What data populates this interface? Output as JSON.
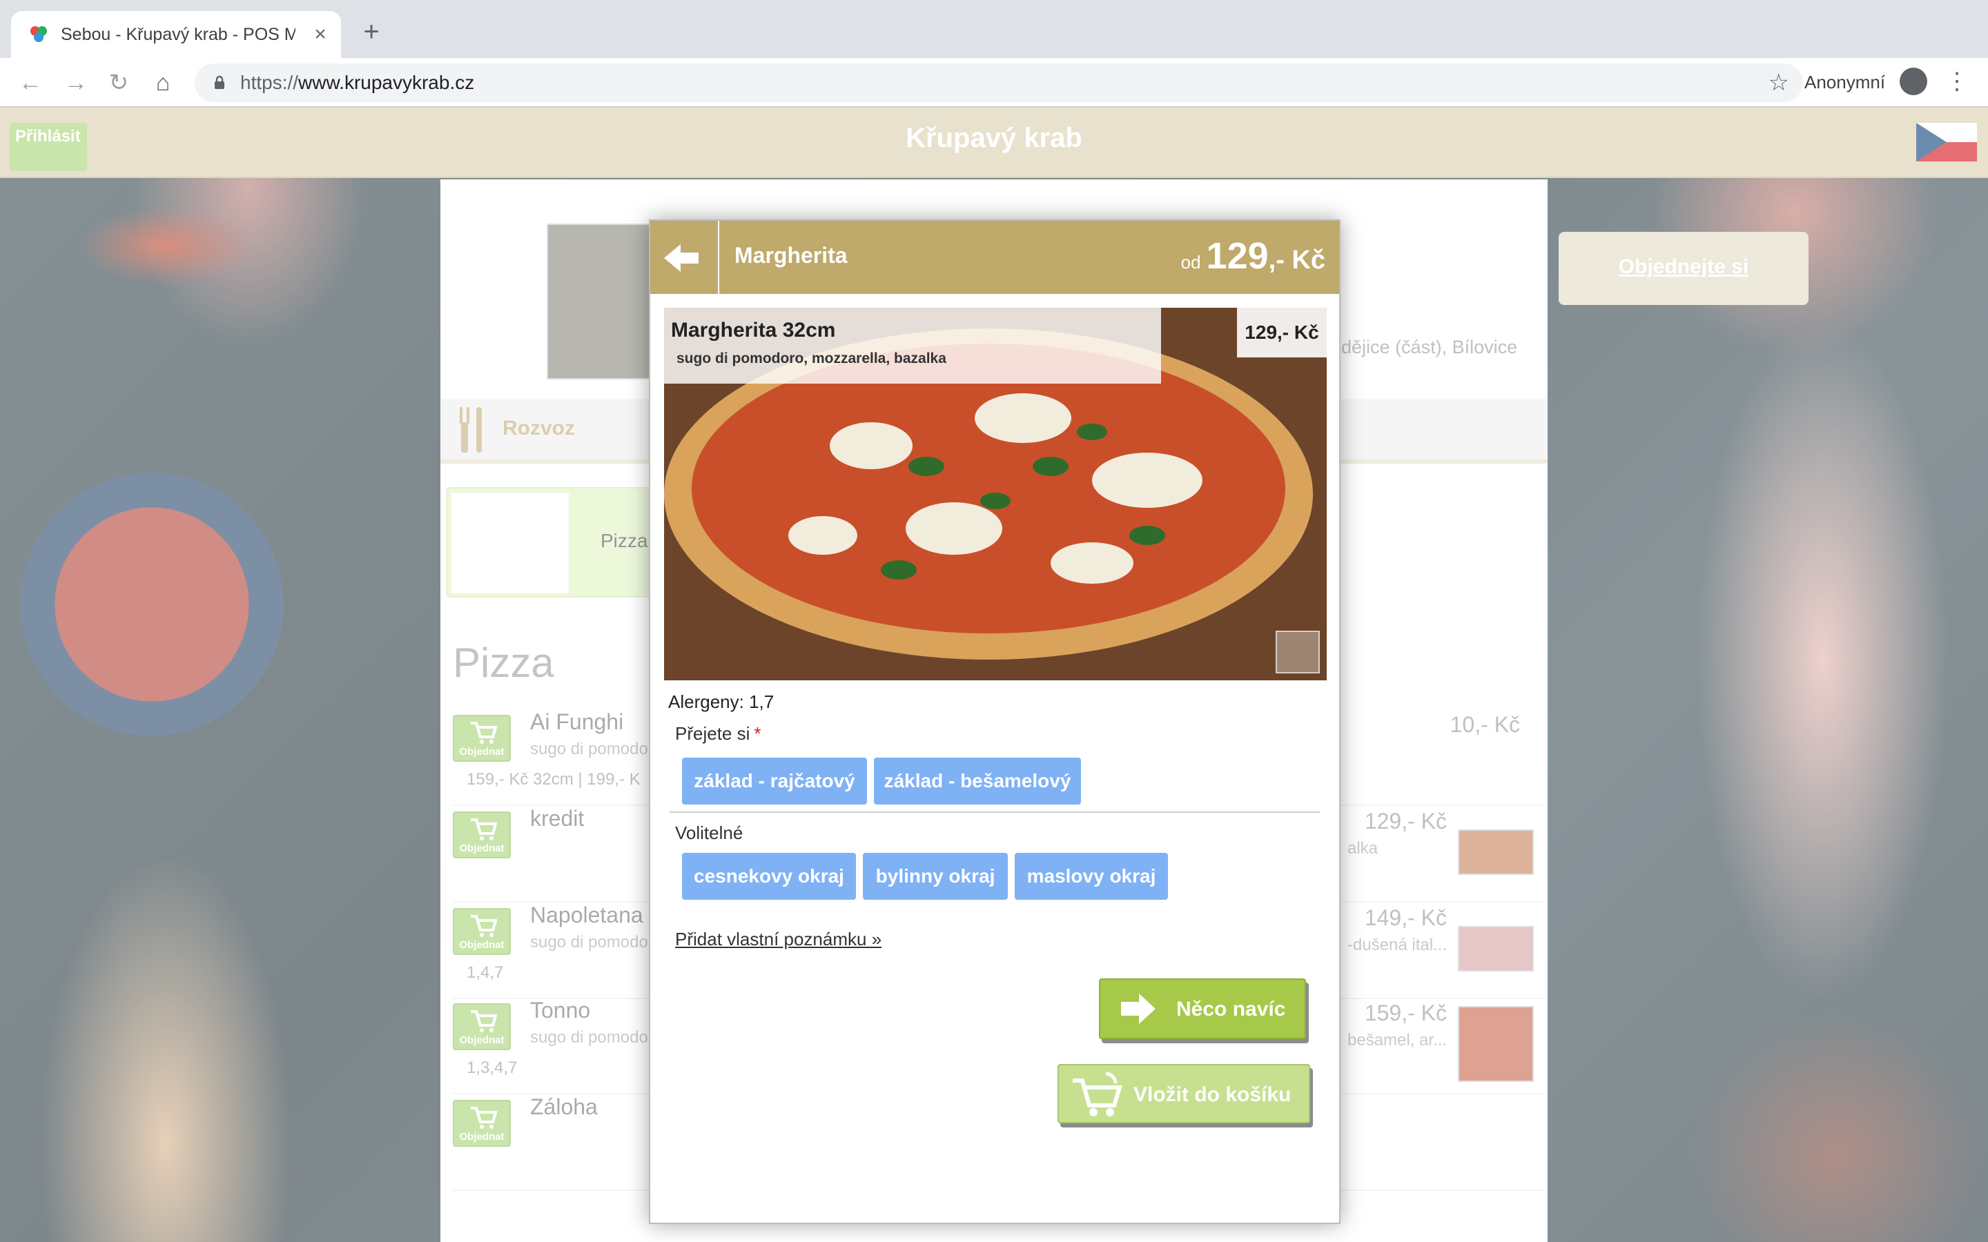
{
  "browser": {
    "tab_title": "Sebou - Křupavý krab - POS M",
    "url_scheme": "https://",
    "url_host": "www.krupavykrab.cz",
    "profile_label": "Anonymní"
  },
  "site": {
    "login_label": "Přihlásit",
    "title": "Křupavý krab",
    "order_cta": "Objednejte si",
    "delivery_label": "Rozvoz",
    "delivery_areas_fragment": "odějice (část), Bílovice",
    "category_name": "Pizza",
    "section_title": "Pizza",
    "order_button_label": "Objednat",
    "menu_items": [
      {
        "name": "Ai Funghi",
        "desc": "sugo di pomodo",
        "extra": "159,- Kč 32cm  |  199,- K",
        "price": "10,- Kč",
        "side_desc": ""
      },
      {
        "name": "kredit",
        "desc": "",
        "extra": "",
        "price": "129,- Kč",
        "side_desc": "alka"
      },
      {
        "name": "Napoletana",
        "desc": "sugo di pomodo",
        "extra": "1,4,7",
        "price": "149,- Kč",
        "side_desc": "-dušená ital..."
      },
      {
        "name": "Tonno",
        "desc": "sugo di pomodo",
        "extra": "1,3,4,7",
        "price": "159,- Kč",
        "side_desc": "bešamel, ar..."
      },
      {
        "name": "Záloha",
        "desc": "",
        "extra": "",
        "price": "",
        "side_desc": ""
      }
    ]
  },
  "modal": {
    "title": "Margherita",
    "price_prefix": "od",
    "price_value": "129",
    "price_suffix": ",- Kč",
    "product_name": "Margherita 32cm",
    "product_desc": "sugo di pomodoro, mozzarella, bazalka",
    "product_price": "129,- Kč",
    "allergens": "Alergeny: 1,7",
    "wish_label": "Přejete si",
    "required_mark": "*",
    "base_options": [
      "základ - rajčatový",
      "základ - bešamelový"
    ],
    "optional_label": "Volitelné",
    "optional_options": [
      "cesnekovy okraj",
      "bylinny okraj",
      "maslovy okraj"
    ],
    "note_link": "Přidat vlastní poznámku »",
    "extra_button": "Něco navíc",
    "cart_button": "Vložit do košíku"
  },
  "colors": {
    "header_band": "#d9cfb1",
    "modal_header": "#bfa96b",
    "option_blue": "#7fb1f5",
    "accent_green": "#a6c94a"
  }
}
